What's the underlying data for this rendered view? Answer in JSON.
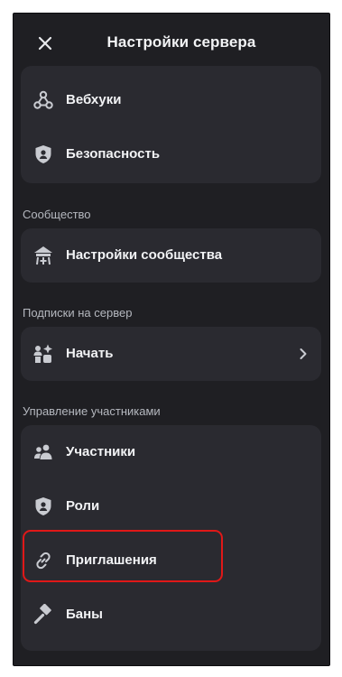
{
  "header": {
    "title": "Настройки сервера",
    "close_icon": "close-icon"
  },
  "groups": [
    {
      "section_label": "",
      "items": [
        {
          "label": "Вебхуки",
          "icon": "webhook-icon"
        },
        {
          "label": "Безопасность",
          "icon": "shield-icon"
        }
      ]
    },
    {
      "section_label": "Сообщество",
      "items": [
        {
          "label": "Настройки сообщества",
          "icon": "community-icon"
        }
      ]
    },
    {
      "section_label": "Подписки на сервер",
      "items": [
        {
          "label": "Начать",
          "icon": "subscriptions-icon",
          "chevron": "chevron-right-icon"
        }
      ]
    },
    {
      "section_label": "Управление участниками",
      "items": [
        {
          "label": "Участники",
          "icon": "members-icon"
        },
        {
          "label": "Роли",
          "icon": "role-shield-icon"
        },
        {
          "label": "Приглашения",
          "icon": "link-icon",
          "highlighted": true
        },
        {
          "label": "Баны",
          "icon": "ban-hammer-icon"
        }
      ]
    }
  ],
  "colors": {
    "background": "#1f1f23",
    "group_background": "#2a2a30",
    "text": "#f2f3f5",
    "section_text": "#b5b8bf",
    "highlight": "#e01818"
  }
}
